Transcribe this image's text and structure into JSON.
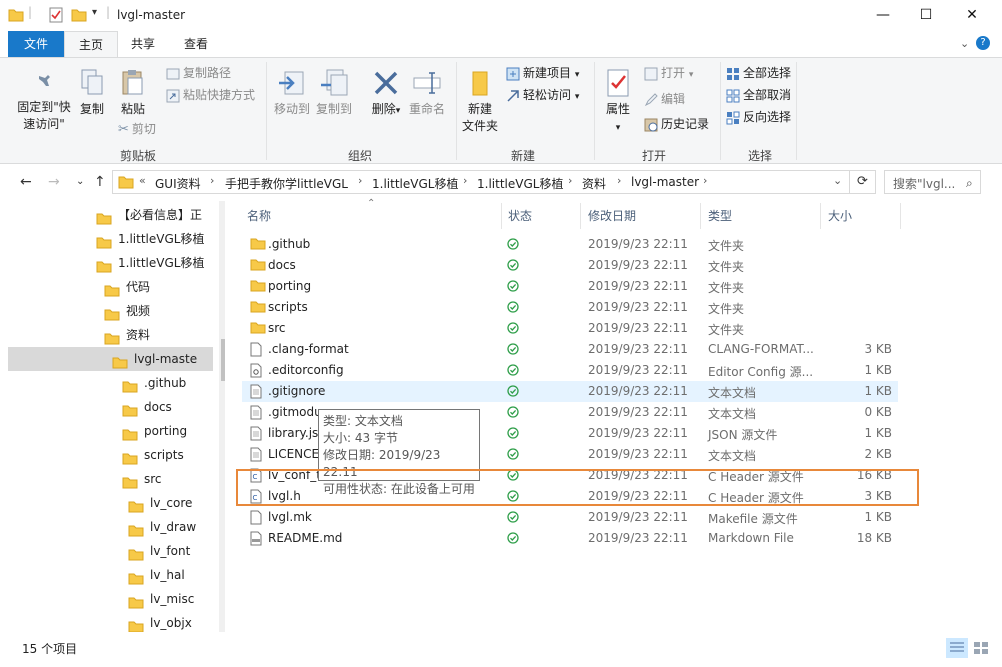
{
  "window": {
    "title": "lvgl-master"
  },
  "ribbon_tabs": {
    "file": "文件",
    "home": "主页",
    "share": "共享",
    "view": "查看"
  },
  "ribbon": {
    "clipboard": {
      "label": "剪贴板",
      "pin": "固定到\"快速访问\"",
      "pin_line1": "固定到\"快",
      "pin_line2": "速访问\"",
      "copy": "复制",
      "paste": "粘贴",
      "copy_path": "复制路径",
      "paste_shortcut": "粘贴快捷方式",
      "cut": "剪切"
    },
    "organize": {
      "label": "组织",
      "move_to": "移动到",
      "copy_to": "复制到",
      "delete": "删除",
      "rename": "重命名"
    },
    "new": {
      "label": "新建",
      "new_folder_line1": "新建",
      "new_folder_line2": "文件夹",
      "new_item": "新建项目",
      "easy_access": "轻松访问"
    },
    "open": {
      "label": "打开",
      "properties": "属性",
      "open": "打开",
      "edit": "编辑",
      "history": "历史记录"
    },
    "select": {
      "label": "选择",
      "select_all": "全部选择",
      "select_none": "全部取消",
      "invert": "反向选择"
    }
  },
  "address": {
    "crumbs": [
      "GUI资料",
      "手把手教你学littleVGL",
      "1.littleVGL移植",
      "1.littleVGL移植",
      "资料",
      "lvgl-master"
    ],
    "overflow": "«",
    "search_placeholder": "搜索\"lvgl..."
  },
  "nav": {
    "items": [
      {
        "label": "【必看信息】正",
        "indent": 0
      },
      {
        "label": "1.littleVGL移植",
        "indent": 0
      },
      {
        "label": "1.littleVGL移植",
        "indent": 1
      },
      {
        "label": "代码",
        "indent": 2
      },
      {
        "label": "视频",
        "indent": 2
      },
      {
        "label": "资料",
        "indent": 2
      },
      {
        "label": "lvgl-maste",
        "indent": 3,
        "selected": true
      },
      {
        "label": ".github",
        "indent": 4
      },
      {
        "label": "docs",
        "indent": 4
      },
      {
        "label": "porting",
        "indent": 4
      },
      {
        "label": "scripts",
        "indent": 4
      },
      {
        "label": "src",
        "indent": 4
      },
      {
        "label": "lv_core",
        "indent": 5
      },
      {
        "label": "lv_draw",
        "indent": 5
      },
      {
        "label": "lv_font",
        "indent": 5
      },
      {
        "label": "lv_hal",
        "indent": 5
      },
      {
        "label": "lv_misc",
        "indent": 5
      },
      {
        "label": "lv_objx",
        "indent": 5
      }
    ]
  },
  "columns": {
    "name": "名称",
    "status": "状态",
    "date": "修改日期",
    "type": "类型",
    "size": "大小"
  },
  "files": [
    {
      "name": ".github",
      "date": "2019/9/23 22:11",
      "type": "文件夹",
      "size": "",
      "kind": "folder"
    },
    {
      "name": "docs",
      "date": "2019/9/23 22:11",
      "type": "文件夹",
      "size": "",
      "kind": "folder"
    },
    {
      "name": "porting",
      "date": "2019/9/23 22:11",
      "type": "文件夹",
      "size": "",
      "kind": "folder"
    },
    {
      "name": "scripts",
      "date": "2019/9/23 22:11",
      "type": "文件夹",
      "size": "",
      "kind": "folder"
    },
    {
      "name": "src",
      "date": "2019/9/23 22:11",
      "type": "文件夹",
      "size": "",
      "kind": "folder"
    },
    {
      "name": ".clang-format",
      "date": "2019/9/23 22:11",
      "type": "CLANG-FORMAT...",
      "size": "3 KB",
      "kind": "file"
    },
    {
      "name": ".editorconfig",
      "date": "2019/9/23 22:11",
      "type": "Editor Config 源...",
      "size": "1 KB",
      "kind": "gear"
    },
    {
      "name": ".gitignore",
      "date": "2019/9/23 22:11",
      "type": "文本文档",
      "size": "1 KB",
      "kind": "text",
      "selected": true
    },
    {
      "name": ".gitmodu",
      "date": "2019/9/23 22:11",
      "type": "文本文档",
      "size": "0 KB",
      "kind": "text"
    },
    {
      "name": "library.js",
      "date": "2019/9/23 22:11",
      "type": "JSON 源文件",
      "size": "1 KB",
      "kind": "text"
    },
    {
      "name": "LICENCE",
      "date": "2019/9/23 22:11",
      "type": "文本文档",
      "size": "2 KB",
      "kind": "text"
    },
    {
      "name": "lv_conf_t",
      "date": "2019/9/23 22:11",
      "type": "C Header 源文件",
      "size": "16 KB",
      "kind": "c"
    },
    {
      "name": "lvgl.h",
      "date": "2019/9/23 22:11",
      "type": "C Header 源文件",
      "size": "3 KB",
      "kind": "c"
    },
    {
      "name": "lvgl.mk",
      "date": "2019/9/23 22:11",
      "type": "Makefile 源文件",
      "size": "1 KB",
      "kind": "file"
    },
    {
      "name": "README.md",
      "date": "2019/9/23 22:11",
      "type": "Markdown File",
      "size": "18 KB",
      "kind": "md"
    }
  ],
  "tooltip": {
    "line1": "类型: 文本文档",
    "line2": "大小: 43 字节",
    "line3": "修改日期: 2019/9/23 22:11",
    "line4": "可用性状态: 在此设备上可用"
  },
  "status": {
    "count": "15 个项目"
  },
  "colors": {
    "accent": "#1979ca",
    "highlight_box": "#e8883a",
    "sync_ok": "#2e9e49",
    "folder": "#f7c948"
  }
}
